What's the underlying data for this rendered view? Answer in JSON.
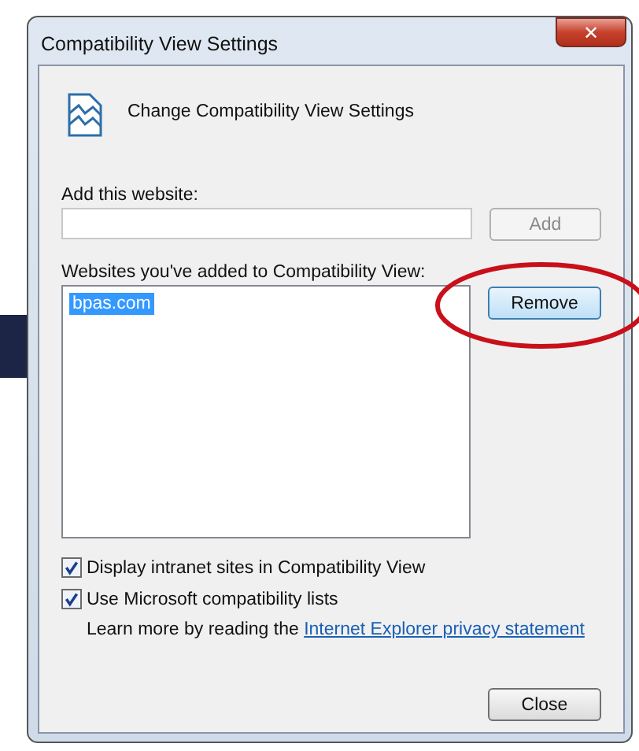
{
  "window": {
    "title": "Compatibility View Settings",
    "close_glyph": "✕"
  },
  "heading": "Change Compatibility View Settings",
  "add_field": {
    "label": "Add this website:"
  },
  "add_button": {
    "label": "Add",
    "disabled": true
  },
  "list": {
    "label": "Websites you've added to Compatibility View:",
    "items": [
      {
        "text": "bpas.com",
        "selected": true
      }
    ]
  },
  "remove_button": {
    "label": "Remove",
    "disabled": false,
    "highlighted": true
  },
  "checkboxes": [
    {
      "label": "Display intranet sites in Compatibility View",
      "checked": true
    },
    {
      "label": "Use Microsoft compatibility lists",
      "checked": true
    }
  ],
  "learn_more": {
    "text": "Learn more by reading the ",
    "link": "Internet Explorer privacy statement"
  },
  "close_button": {
    "label": "Close",
    "disabled": false,
    "highlighted": false
  },
  "annotation": {
    "kind": "ellipse"
  }
}
